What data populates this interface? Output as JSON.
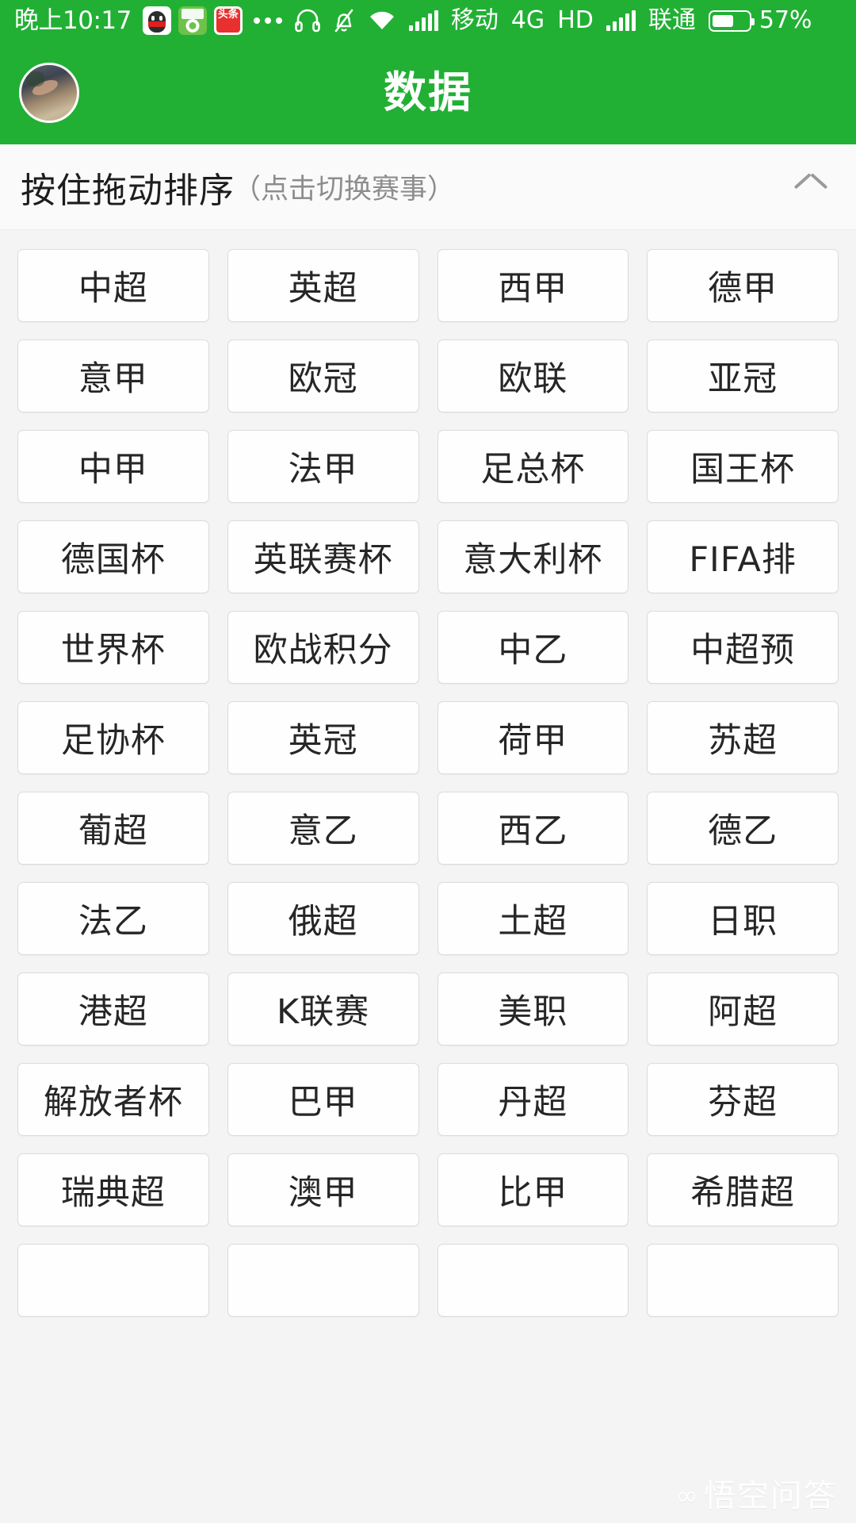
{
  "status_bar": {
    "clock": "晚上10:17",
    "app_icons": [
      "qq-icon",
      "football-app-icon",
      "toutiao-icon"
    ],
    "overflow_icon": "more-dots-icon",
    "headset_icon": "headset-icon",
    "silent_icon": "bell-muted-icon",
    "wifi_icon": "wifi-icon",
    "signal1_icon": "signal-bars-icon",
    "carrier1": "移动",
    "network": "4G",
    "hd": "HD",
    "signal2_icon": "signal-bars-icon",
    "carrier2": "联通",
    "battery_icon": "battery-icon",
    "battery_percent": "57%"
  },
  "header": {
    "avatar": "user-avatar",
    "title": "数据"
  },
  "sort_bar": {
    "main_label": "按住拖动排序",
    "sub_label": "（点击切换赛事）",
    "collapse_icon": "chevron-up-icon"
  },
  "leagues": [
    "中超",
    "英超",
    "西甲",
    "德甲",
    "意甲",
    "欧冠",
    "欧联",
    "亚冠",
    "中甲",
    "法甲",
    "足总杯",
    "国王杯",
    "德国杯",
    "英联赛杯",
    "意大利杯",
    "FIFA排",
    "世界杯",
    "欧战积分",
    "中乙",
    "中超预",
    "足协杯",
    "英冠",
    "荷甲",
    "苏超",
    "葡超",
    "意乙",
    "西乙",
    "德乙",
    "法乙",
    "俄超",
    "土超",
    "日职",
    "港超",
    "K联赛",
    "美职",
    "阿超",
    "解放者杯",
    "巴甲",
    "丹超",
    "芬超",
    "瑞典超",
    "澳甲",
    "比甲",
    "希腊超",
    "",
    "",
    "",
    ""
  ],
  "watermark": {
    "mark": "∞",
    "text": "悟空问答"
  },
  "colors": {
    "brand_green": "#21B034",
    "page_bg": "#F4F4F4",
    "button_bg": "#FEFEFE",
    "button_border": "#DCDCDC",
    "text_primary": "#262626",
    "text_muted": "#8d8d8d"
  }
}
